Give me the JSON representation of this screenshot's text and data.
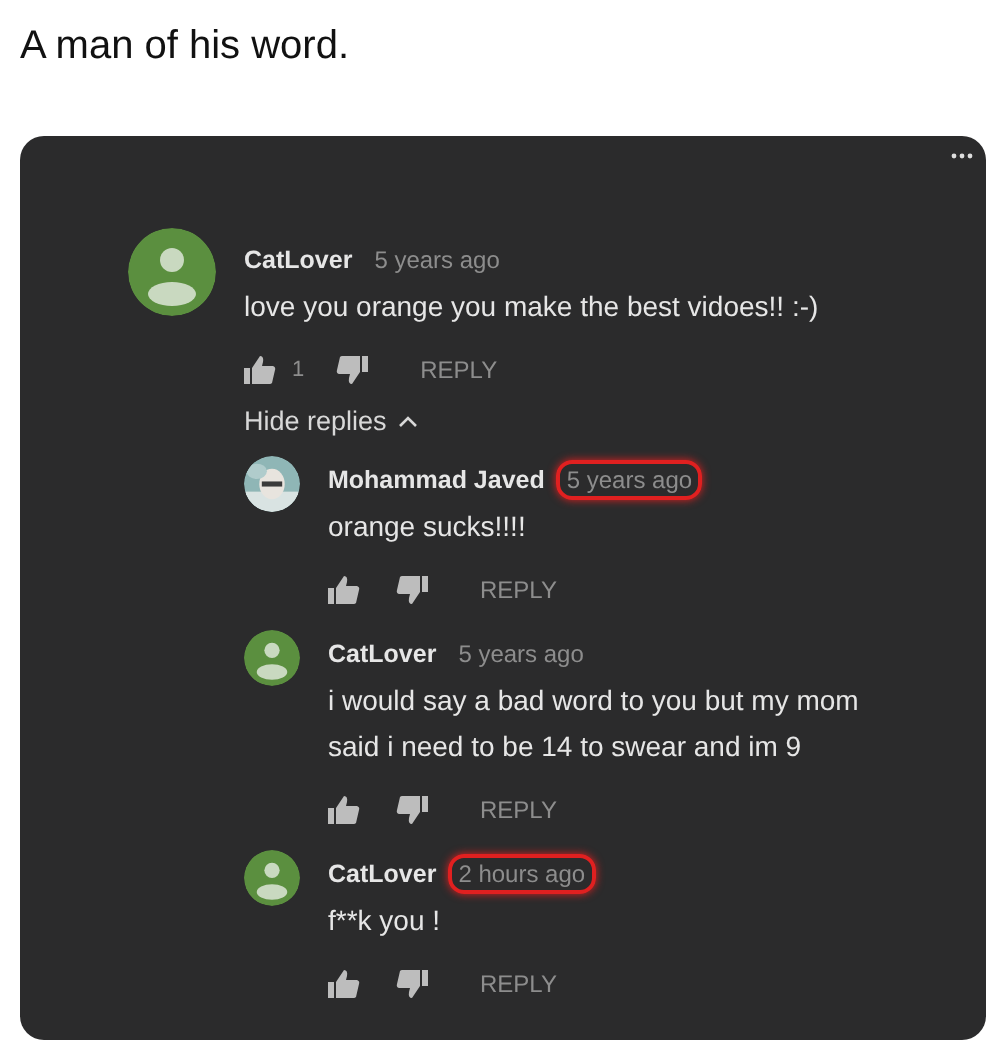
{
  "post": {
    "caption": "A man of his word."
  },
  "comment": {
    "author": "CatLover",
    "time": "5 years ago",
    "time_highlighted": false,
    "avatar": {
      "kind": "default"
    },
    "text": "love you orange you make the best vidoes!! :-)",
    "likes": "1",
    "reply_label": "REPLY",
    "replies_toggle": {
      "label": "Hide replies",
      "expanded": true
    },
    "replies": [
      {
        "author": "Mohammad Javed",
        "time": "5 years ago",
        "time_highlighted": true,
        "text": "orange sucks!!!!",
        "reply_label": "REPLY"
      },
      {
        "author": "CatLover",
        "time": "5 years ago",
        "time_highlighted": false,
        "avatar": {
          "kind": "default"
        },
        "text": "i would say a bad word to you but my mom said i need to be 14 to swear and im 9",
        "reply_label": "REPLY"
      },
      {
        "author": "CatLover",
        "time": "2 hours ago",
        "time_highlighted": true,
        "avatar": {
          "kind": "default"
        },
        "text": "f**k you !",
        "reply_label": "REPLY"
      }
    ]
  }
}
